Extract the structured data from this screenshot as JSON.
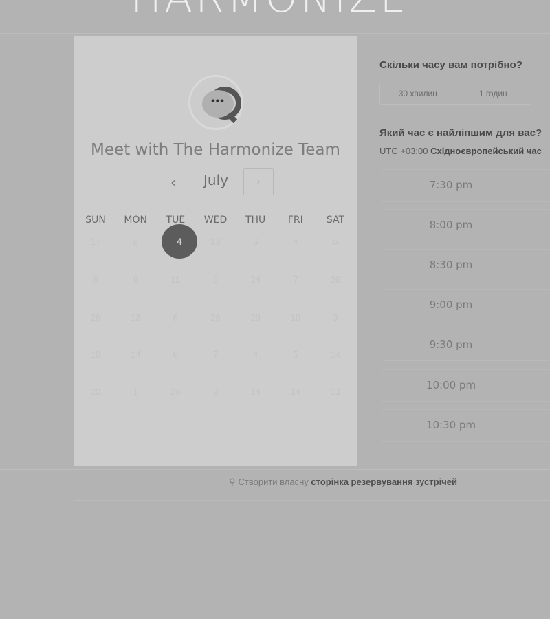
{
  "brand": {
    "partial_title": "HARMONIZE"
  },
  "booking": {
    "title": "Meet with The Harmonize Team",
    "month": "July",
    "prev_icon": "‹",
    "next_icon": "›",
    "weekdays": [
      "SUN",
      "MON",
      "TUE",
      "WED",
      "THU",
      "FRI",
      "SAT"
    ],
    "weeks": [
      [
        "17",
        "8",
        "",
        "13",
        "6",
        "4",
        "5"
      ],
      [
        "8",
        "9",
        "11",
        "5",
        "24",
        "7",
        "26"
      ],
      [
        "26",
        "13",
        "6",
        "28",
        "29",
        "10",
        "3"
      ],
      [
        "10",
        "14",
        "6",
        "7",
        "4",
        "5",
        "14"
      ],
      [
        "20",
        "1",
        "28",
        "9",
        "14",
        "14",
        "13"
      ]
    ],
    "selected_day": "4"
  },
  "duration": {
    "question": "Скільки часу вам потрібно?",
    "options": [
      "30 хвилин",
      "1 годин"
    ]
  },
  "time": {
    "question": "Який час є найліпшим для вас?",
    "tz_offset": "UTC +03:00",
    "tz_name": "Східноєвропейський час",
    "slots": [
      "7:30 pm",
      "8:00 pm",
      "8:30 pm",
      "9:00 pm",
      "9:30 pm",
      "10:00 pm",
      "10:30 pm"
    ]
  },
  "footer": {
    "prefix": "Створити власну",
    "link": "сторінка резервування зустрічей"
  },
  "colors": {
    "selected_day": "#5c5c5c",
    "card_bg": "#cdcdcd",
    "page_bg": "#b3b3b3"
  }
}
